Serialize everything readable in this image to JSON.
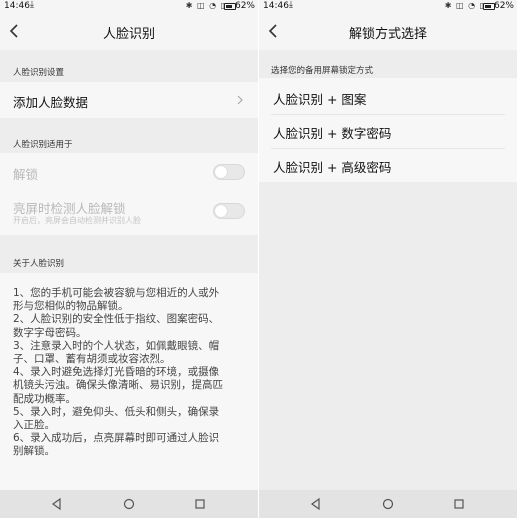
{
  "statusbar": {
    "time": "14:46",
    "battery": "62%"
  },
  "left": {
    "title": "人脸识别",
    "section_settings": "人脸识别设置",
    "add_face": "添加人脸数据",
    "section_apply": "人脸识别适用于",
    "unlock_label": "解锁",
    "screen_on_label": "亮屏时检测人脸解锁",
    "screen_on_sub": "开启后，亮屏会自动检测并识别人脸",
    "section_about": "关于人脸识别",
    "about": [
      "1、您的手机可能会被容貌与您相近的人或外",
      "形与您相似的物品解锁。",
      "2、人脸识别的安全性低于指纹、图案密码、",
      "数字字母密码。",
      "3、注意录入时的个人状态，如佩戴眼镜、帽",
      "子、口罩、蓄有胡须或妆容浓烈。",
      "4、录入时避免选择灯光昏暗的环境，或摄像",
      "机镜头污浊。确保头像清晰、易识别，提高匹",
      "配成功概率。",
      "5、录入时，避免仰头、低头和侧头，确保录",
      "入正脸。",
      "6、录入成功后，点亮屏幕时即可通过人脸识",
      "别解锁。"
    ],
    "toggles": {
      "unlock": false,
      "screen_on_detect": false
    }
  },
  "right": {
    "title": "解锁方式选择",
    "hint": "选择您的备用屏幕锁定方式",
    "options": [
      "人脸识别 + 图案",
      "人脸识别 + 数字密码",
      "人脸识别 + 高级密码"
    ]
  },
  "icons": {
    "back": "back-arrow-icon",
    "chevron": "chevron-right-icon",
    "nav_back": "triangle-back-icon",
    "nav_home": "circle-home-icon",
    "nav_recent": "square-recents-icon"
  }
}
